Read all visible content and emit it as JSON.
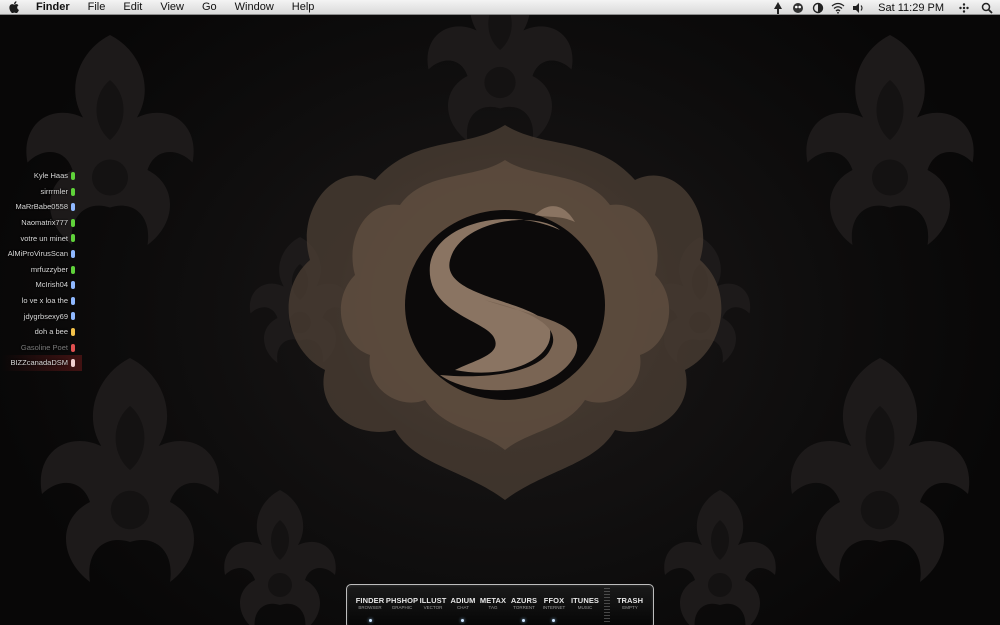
{
  "menubar": {
    "apple_icon": "apple-icon",
    "app_name": "Finder",
    "menus": [
      "File",
      "Edit",
      "View",
      "Go",
      "Window",
      "Help"
    ],
    "status_icons": [
      "tree-icon",
      "growl-icon",
      "sync-icon",
      "wifi-icon",
      "volume-icon"
    ],
    "clock": "Sat 11:29 PM",
    "extra_icons": [
      "dots-icon",
      "spotlight-icon"
    ]
  },
  "buddy_list": [
    {
      "name": "Kyle   Haas",
      "status": "available",
      "color": "#5fd23a"
    },
    {
      "name": "sirrrmler",
      "status": "available",
      "color": "#5fd23a"
    },
    {
      "name": "MaRrBabe0558",
      "status": "mobile",
      "color": "#8fb8ff"
    },
    {
      "name": "Naomatrix777",
      "status": "available",
      "color": "#5fd23a"
    },
    {
      "name": "votre un minet",
      "status": "available",
      "color": "#5fd23a"
    },
    {
      "name": "AlMiProVirusScan",
      "status": "mobile",
      "color": "#8fb8ff"
    },
    {
      "name": "mrfuzzyber",
      "status": "available",
      "color": "#5fd23a"
    },
    {
      "name": "McIrish04",
      "status": "mobile",
      "color": "#8fb8ff"
    },
    {
      "name": "lo ve x loa the",
      "status": "mobile",
      "color": "#8fb8ff"
    },
    {
      "name": "jdygrbsexy69",
      "status": "mobile",
      "color": "#8fb8ff"
    },
    {
      "name": "doh a bee",
      "status": "idle",
      "color": "#f2c14a"
    },
    {
      "name": "Gasoline Poet",
      "status": "away",
      "color": "#e05050"
    },
    {
      "name": "BIZZcanadaDSM",
      "status": "away",
      "color": "#f0d0d0"
    }
  ],
  "dock": {
    "items": [
      {
        "label": "FINDER",
        "sub": "BROWSER",
        "running": true
      },
      {
        "label": "PHSHOP",
        "sub": "GRAPHIC",
        "running": false
      },
      {
        "label": "ILLUST",
        "sub": "VECTOR",
        "running": false
      },
      {
        "label": "ADIUM",
        "sub": "CHAT",
        "running": true
      },
      {
        "label": "METAX",
        "sub": "TAG",
        "running": false
      },
      {
        "label": "AZURS",
        "sub": "TORRENT",
        "running": true
      },
      {
        "label": "FFOX",
        "sub": "INTERNET",
        "running": true
      },
      {
        "label": "ITUNES",
        "sub": "MUSIC",
        "running": false
      },
      {
        "label": "TRASH",
        "sub": "EMPTY",
        "running": false
      }
    ]
  },
  "colors": {
    "menubar_bg": "#e6e6e6",
    "wallpaper_bg": "#0d0c0c",
    "emblem_bronze": "#8a7462"
  }
}
